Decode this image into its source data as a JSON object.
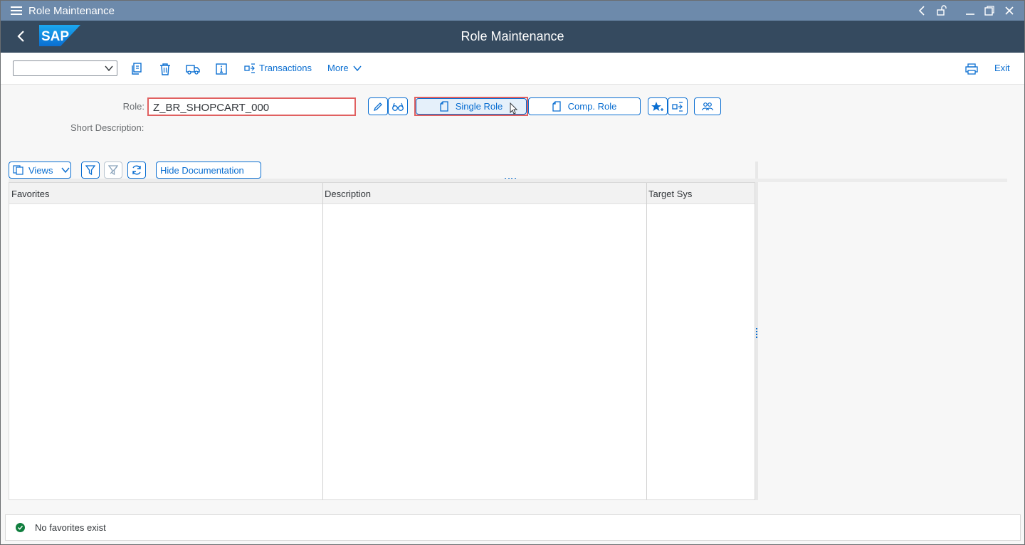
{
  "window": {
    "title": "Role Maintenance"
  },
  "shell": {
    "title": "Role Maintenance",
    "logo_text": "SAP"
  },
  "toolbar": {
    "transactions_label": "Transactions",
    "more_label": "More",
    "exit_label": "Exit"
  },
  "form": {
    "role_label": "Role:",
    "role_value": "Z_BR_SHOPCART_000",
    "short_description_label": "Short Description:",
    "single_role_label": "Single Role",
    "comp_role_label": "Comp. Role"
  },
  "table_toolbar": {
    "views_label": "Views",
    "hide_doc_label": "Hide Documentation"
  },
  "table": {
    "columns": [
      "Favorites",
      "Description",
      "Target Sys"
    ]
  },
  "status": {
    "message": "No favorites exist"
  },
  "colors": {
    "shell": "#354a5f",
    "titlebar": "#6d8aab",
    "accent": "#0a6ed1",
    "highlight": "#e06060",
    "success": "#107e3e"
  }
}
